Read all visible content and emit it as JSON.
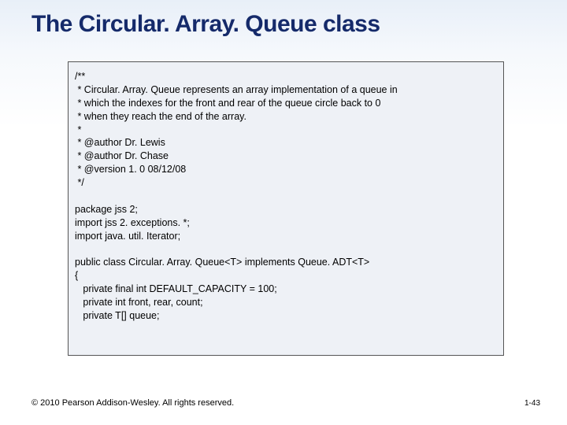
{
  "title": "The Circular. Array. Queue class",
  "code": "/**\n * Circular. Array. Queue represents an array implementation of a queue in\n * which the indexes for the front and rear of the queue circle back to 0\n * when they reach the end of the array.\n *\n * @author Dr. Lewis\n * @author Dr. Chase\n * @version 1. 0 08/12/08\n */\n\npackage jss 2;\nimport jss 2. exceptions. *;\nimport java. util. Iterator;\n\npublic class Circular. Array. Queue<T> implements Queue. ADT<T>\n{\n   private final int DEFAULT_CAPACITY = 100;\n   private int front, rear, count;\n   private T[] queue;",
  "footer_left": "© 2010 Pearson Addison-Wesley. All rights reserved.",
  "footer_right": "1-43"
}
